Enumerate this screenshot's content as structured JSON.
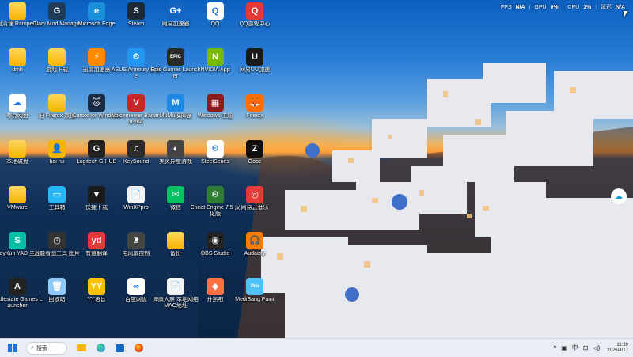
{
  "perf": {
    "fps_label": "FPS",
    "fps_value": "N/A",
    "gpu_label": "GPU",
    "gpu_value": "0%",
    "cpu_label": "CPU",
    "cpu_value": "1%",
    "latency_label": "延迟",
    "latency_value": "N/A"
  },
  "icons": [
    {
      "label": "C盘清理 Ramper(…",
      "kind": "folder"
    },
    {
      "label": "Glary Mod Manager",
      "kind": "app",
      "color": "#1f3b5a",
      "glyph": "G"
    },
    {
      "label": "Microsoft Edge",
      "kind": "app",
      "color": "#1c8fd9",
      "glyph": "e"
    },
    {
      "label": "Steam",
      "kind": "app",
      "color": "#1b2838",
      "glyph": "S"
    },
    {
      "label": "网易加速器",
      "kind": "app",
      "color": "#1565c0",
      "glyph": "G+"
    },
    {
      "label": "QQ",
      "kind": "app",
      "color": "#ffffff",
      "glyph": "Q"
    },
    {
      "label": "QQ游戏中心",
      "kind": "app",
      "color": "#e53935",
      "glyph": "Q"
    },
    {
      "label": "dmh",
      "kind": "folder"
    },
    {
      "label": "游戏下载",
      "kind": "folder"
    },
    {
      "label": "迅雷加速器",
      "kind": "app",
      "color": "#ff8a00",
      "glyph": "⚡"
    },
    {
      "label": "ASUS Armoury Crate",
      "kind": "app",
      "color": "#2196f3",
      "glyph": "⚙"
    },
    {
      "label": "Epic Games Launcher",
      "kind": "app",
      "color": "#2a2a2a",
      "glyph": "EPIC"
    },
    {
      "label": "NVIDIA App",
      "kind": "app",
      "color": "#76b900",
      "glyph": "N"
    },
    {
      "label": "网易UU加速",
      "kind": "app",
      "color": "#1a1a1a",
      "glyph": "U"
    },
    {
      "label": "夸克网盘",
      "kind": "app",
      "color": "#ffffff",
      "glyph": "☁"
    },
    {
      "label": "旧 Firefox 数据",
      "kind": "folder"
    },
    {
      "label": "Cursor for Windows",
      "kind": "app",
      "color": "#1a2b44",
      "glyph": "🐱"
    },
    {
      "label": "Voicemeeter Banana x64",
      "kind": "app",
      "color": "#c62828",
      "glyph": "V"
    },
    {
      "label": "MuMu模拟器",
      "kind": "app",
      "color": "#1e88e5",
      "glyph": "M"
    },
    {
      "label": "Windows 主题",
      "kind": "app",
      "color": "#8d1b1b",
      "glyph": "▦"
    },
    {
      "label": "Firefox",
      "kind": "app",
      "color": "#ff6d00",
      "glyph": "🦊"
    },
    {
      "label": "本地磁盘",
      "kind": "folder"
    },
    {
      "label": "bai rui",
      "kind": "app",
      "color": "#f5b400",
      "glyph": "👤"
    },
    {
      "label": "Logitech G HUB",
      "kind": "app",
      "color": "#222222",
      "glyph": "G"
    },
    {
      "label": "KeySound",
      "kind": "app",
      "color": "#2b2b2b",
      "glyph": "♫"
    },
    {
      "label": "美灵异度游戏",
      "kind": "app",
      "color": "#444444",
      "glyph": "◐"
    },
    {
      "label": "SteelSeries",
      "kind": "app",
      "color": "#ffffff",
      "glyph": "⚙"
    },
    {
      "label": "Oopz",
      "kind": "app",
      "color": "#111111",
      "glyph": "Z"
    },
    {
      "label": "VMware",
      "kind": "folder"
    },
    {
      "label": "工具箱",
      "kind": "app",
      "color": "#29b6f6",
      "glyph": "▭"
    },
    {
      "label": "快捷下载",
      "kind": "app",
      "color": "#1b1b1b",
      "glyph": "▼"
    },
    {
      "label": "WinXPpro",
      "kind": "app",
      "color": "#f2f2f2",
      "glyph": "📄"
    },
    {
      "label": "微信",
      "kind": "app",
      "color": "#07c160",
      "glyph": "✉"
    },
    {
      "label": "Cheat Engine 7.5 汉化版",
      "kind": "app",
      "color": "#2e7d32",
      "glyph": "⚙"
    },
    {
      "label": "网易云音乐",
      "kind": "app",
      "color": "#e53935",
      "glyph": "◎"
    },
    {
      "label": "WeyKun YAD 主题",
      "kind": "app",
      "color": "#00bfa5",
      "glyph": "S"
    },
    {
      "label": "万能看图工具 图片",
      "kind": "app",
      "color": "#333333",
      "glyph": "◷"
    },
    {
      "label": "有道翻译",
      "kind": "app",
      "color": "#e53935",
      "glyph": "yd"
    },
    {
      "label": "电风扇控制",
      "kind": "app",
      "color": "#444444",
      "glyph": "♜"
    },
    {
      "label": "备份",
      "kind": "folder"
    },
    {
      "label": "OBS Studio",
      "kind": "app",
      "color": "#222222",
      "glyph": "◉"
    },
    {
      "label": "Audacity",
      "kind": "app",
      "color": "#f57c00",
      "glyph": "🎧"
    },
    {
      "label": "Battlestate Games Launcher",
      "kind": "app",
      "color": "#222222",
      "glyph": "A"
    },
    {
      "label": "回收站",
      "kind": "app",
      "color": "#90caf9",
      "glyph": "🗑"
    },
    {
      "label": "YY语音",
      "kind": "app",
      "color": "#ffc107",
      "glyph": "YY"
    },
    {
      "label": "百度网盘",
      "kind": "app",
      "color": "#ffffff",
      "glyph": "∞"
    },
    {
      "label": "海康大屏 本地网络 MAC地址",
      "kind": "app",
      "color": "#f2f2f2",
      "glyph": "📄"
    },
    {
      "label": "开黑啦",
      "kind": "app",
      "color": "#ff7043",
      "glyph": "◆"
    },
    {
      "label": "MediBang Paint",
      "kind": "app",
      "color": "#4fc3f7",
      "glyph": "Pro"
    }
  ],
  "taskbar": {
    "search_label": "搜索",
    "time": "11:39",
    "date": "2026/4/17"
  }
}
